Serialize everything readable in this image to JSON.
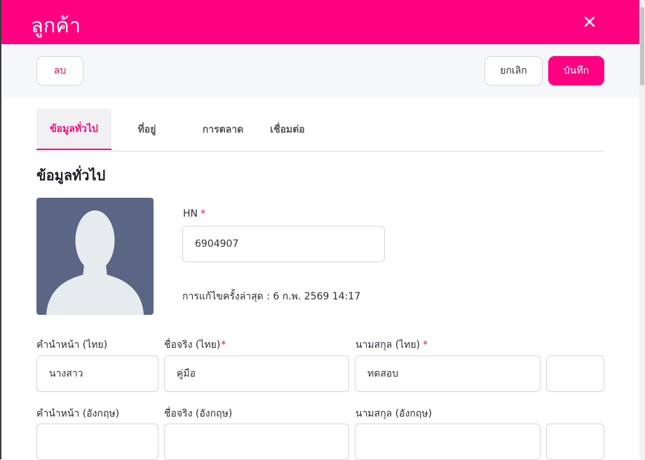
{
  "header": {
    "title": "ลูกค้า"
  },
  "toolbar": {
    "delete_label": "ลบ",
    "cancel_label": "ยกเลิก",
    "save_label": "บันทึก"
  },
  "tabs": [
    {
      "label": "ข้อมูลทั่วไป",
      "active": true
    },
    {
      "label": "ที่อยู่",
      "active": false
    },
    {
      "label": "การตลาด",
      "active": false
    },
    {
      "label": "เชื่อมต่อ",
      "active": false
    }
  ],
  "section": {
    "title": "ข้อมูลทั่วไป"
  },
  "hn": {
    "label": "HN",
    "value": "6904907"
  },
  "last_edited": "การแก้ไขครั้งล่าสุด : 6 ก.พ. 2569 14:17",
  "fields_th": {
    "prefix_label": "คำนำหน้า (ไทย)",
    "prefix_value": "นางสาว",
    "first_label": "ชื่อจริง (ไทย)",
    "first_value": "คู่มือ",
    "last_label": "นามสกุล (ไทย)",
    "last_value": "ทดสอบ"
  },
  "fields_en": {
    "prefix_label": "คำนำหน้า (อังกฤษ)",
    "prefix_value": "",
    "first_label": "ชื่อจริง (อังกฤษ)",
    "first_value": "",
    "last_label": "นามสกุล (อังกฤษ)",
    "last_value": ""
  },
  "required_mark": "*",
  "colors": {
    "brand": "#ff0080",
    "required": "#e8123c",
    "avatar_bg": "#5b6584"
  },
  "icons": {
    "close": "close-icon",
    "avatar": "user-silhouette-icon"
  }
}
